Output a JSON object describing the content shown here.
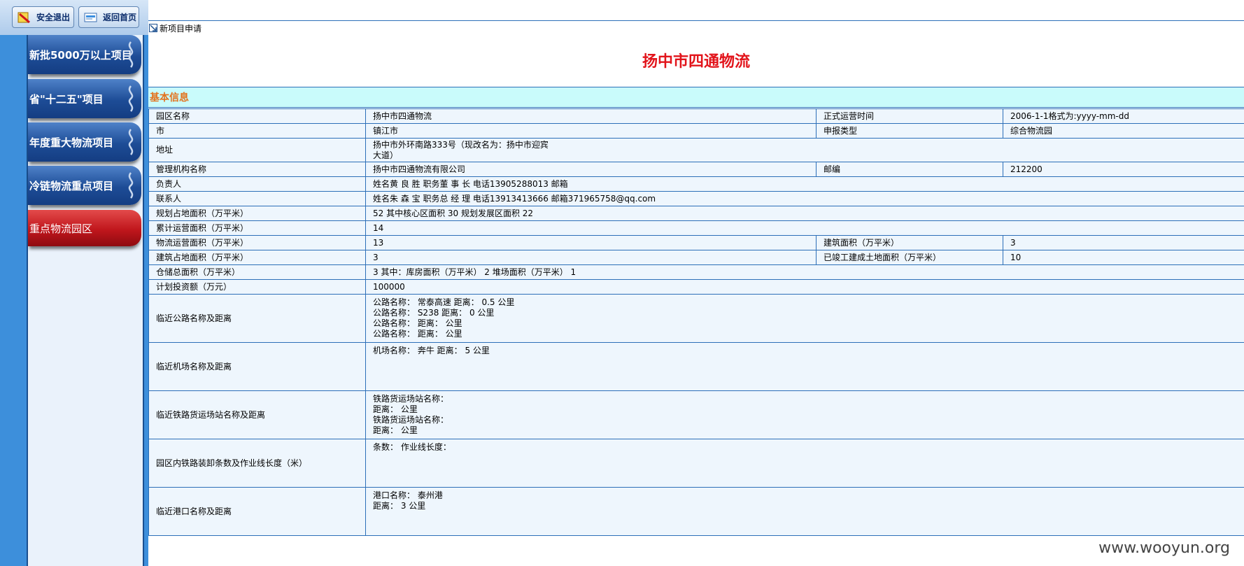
{
  "sidebar": {
    "buttons": {
      "logout": "安全退出",
      "home": "返回首页"
    },
    "nav": [
      {
        "label": "新批5000万以上项目",
        "active": false
      },
      {
        "label": "省\"十二五\"项目",
        "active": false
      },
      {
        "label": "年度重大物流项目",
        "active": false
      },
      {
        "label": "冷链物流重点项目",
        "active": false
      },
      {
        "label": "重点物流园区",
        "active": true
      }
    ]
  },
  "breadcrumb": "新项目申请",
  "project_title": "扬中市四通物流",
  "section_title": "基本信息",
  "rows": {
    "park_name": {
      "label": "园区名称",
      "value": "扬中市四通物流"
    },
    "op_time": {
      "label": "正式运营时间",
      "value": "2006-1-1格式为:yyyy-mm-dd"
    },
    "city": {
      "label": "市",
      "value": "镇江市"
    },
    "report_type": {
      "label": "申报类型",
      "value": "综合物流园"
    },
    "address": {
      "label": "地址",
      "value1": "扬中市外环南路333号（现改名为：扬中市迎宾",
      "value2": "大道）"
    },
    "mgmt": {
      "label": "管理机构名称",
      "value": "扬中市四通物流有限公司"
    },
    "postcode": {
      "label": "邮编",
      "value": "212200"
    },
    "leader": {
      "label": "负责人",
      "value": "姓名黄 良 胜 职务董 事 长 电话13905288013 邮箱"
    },
    "contact": {
      "label": "联系人",
      "value": "姓名朱 森 宝 职务总 经 理 电话13913413666 邮箱371965758@qq.com"
    },
    "plan_area": {
      "label": "规划占地面积（万平米）",
      "value": "52 其中核心区面积 30 规划发展区面积 22"
    },
    "cum_area": {
      "label": "累计运营面积（万平米）",
      "value": "14"
    },
    "logi_area": {
      "label": "物流运营面积（万平米）",
      "value": "13"
    },
    "build_area": {
      "label": "建筑面积（万平米）",
      "value": "3"
    },
    "build_land": {
      "label": "建筑占地面积（万平米）",
      "value": "3"
    },
    "done_land": {
      "label": "已竣工建成土地面积（万平米）",
      "value": "10"
    },
    "storage": {
      "label": "仓储总面积（万平米）",
      "value": "3 其中：库房面积（万平米） 2 堆场面积（万平米） 1"
    },
    "invest": {
      "label": "计划投资额（万元）",
      "value": "100000"
    },
    "road": {
      "label": "临近公路名称及距离",
      "lines": [
        "公路名称： 常泰高速 距离： 0.5 公里",
        "公路名称： S238 距离： 0 公里",
        "公路名称： 距离： 公里",
        "公路名称： 距离： 公里"
      ]
    },
    "airport": {
      "label": "临近机场名称及距离",
      "value": "机场名称： 奔牛 距离： 5 公里"
    },
    "rail": {
      "label": "临近铁路货运场站名称及距离",
      "lines": [
        "铁路货运场站名称：",
        "距离： 公里",
        "铁路货运场站名称：",
        "距离： 公里"
      ]
    },
    "rail_in": {
      "label": "园区内铁路装卸条数及作业线长度（米）",
      "value": "条数： 作业线长度："
    },
    "port": {
      "label": "临近港口名称及距离",
      "lines": [
        "港口名称： 泰州港",
        "距离： 3 公里"
      ]
    }
  },
  "watermark": "www.wooyun.org"
}
